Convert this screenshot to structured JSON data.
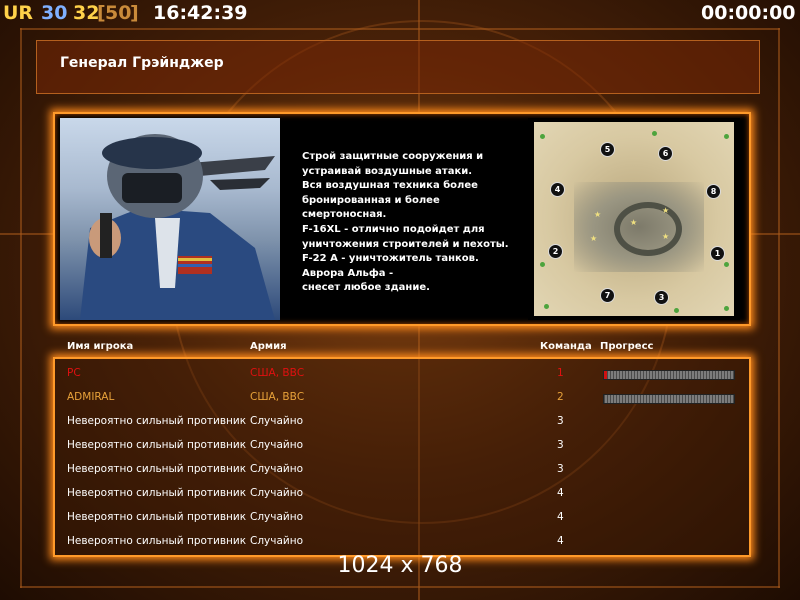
{
  "topbar": {
    "ur_label": "UR",
    "num1": "30",
    "num2": "32",
    "bracket_open": "[",
    "num3": "50",
    "bracket_close": "]",
    "clock": "16:42:39",
    "timer": "00:00:00"
  },
  "header": {
    "title": "Генерал Грэйнджер"
  },
  "briefing": {
    "text": "Строй защитные сооружения и\n устраивай воздушные атаки.\nВся воздушная техника более\n бронированная и более\nсмертоносная.\nF-16XL - отлично подойдет для\n уничтожения строителей и пехоты.\nF-22 A - уничтожитель танков.\nАврора Альфа -\nснесет любое здание."
  },
  "map": {
    "spawns": [
      "5",
      "6",
      "4",
      "8",
      "2",
      "1",
      "7",
      "3"
    ]
  },
  "table": {
    "headers": {
      "name": "Имя игрока",
      "army": "Армия",
      "team": "Команда",
      "progress": "Прогресс"
    },
    "rows": [
      {
        "name": "PC",
        "army": "США, ВВС",
        "team": "1",
        "progress": 0.02,
        "color": "#e01010"
      },
      {
        "name": "ADMIRAL",
        "army": "США, ВВС",
        "team": "2",
        "progress": 0,
        "color": "#e8a23a"
      },
      {
        "name": "Невероятно сильный противник",
        "army": "Случайно",
        "team": "3",
        "color": "#ffffff"
      },
      {
        "name": "Невероятно сильный противник",
        "army": "Случайно",
        "team": "3",
        "color": "#ffffff"
      },
      {
        "name": "Невероятно сильный противник",
        "army": "Случайно",
        "team": "3",
        "color": "#ffffff"
      },
      {
        "name": "Невероятно сильный противник",
        "army": "Случайно",
        "team": "4",
        "color": "#ffffff"
      },
      {
        "name": "Невероятно сильный противник",
        "army": "Случайно",
        "team": "4",
        "color": "#ffffff"
      },
      {
        "name": "Невероятно сильный противник",
        "army": "Случайно",
        "team": "4",
        "color": "#ffffff"
      }
    ]
  },
  "resolution": "1024 x 768",
  "colors": {
    "accent": "#ff9a2a",
    "ur": "#ffd24a",
    "num1": "#7fb0ff",
    "num2": "#ffd24a",
    "num3": "#c98a3a"
  }
}
